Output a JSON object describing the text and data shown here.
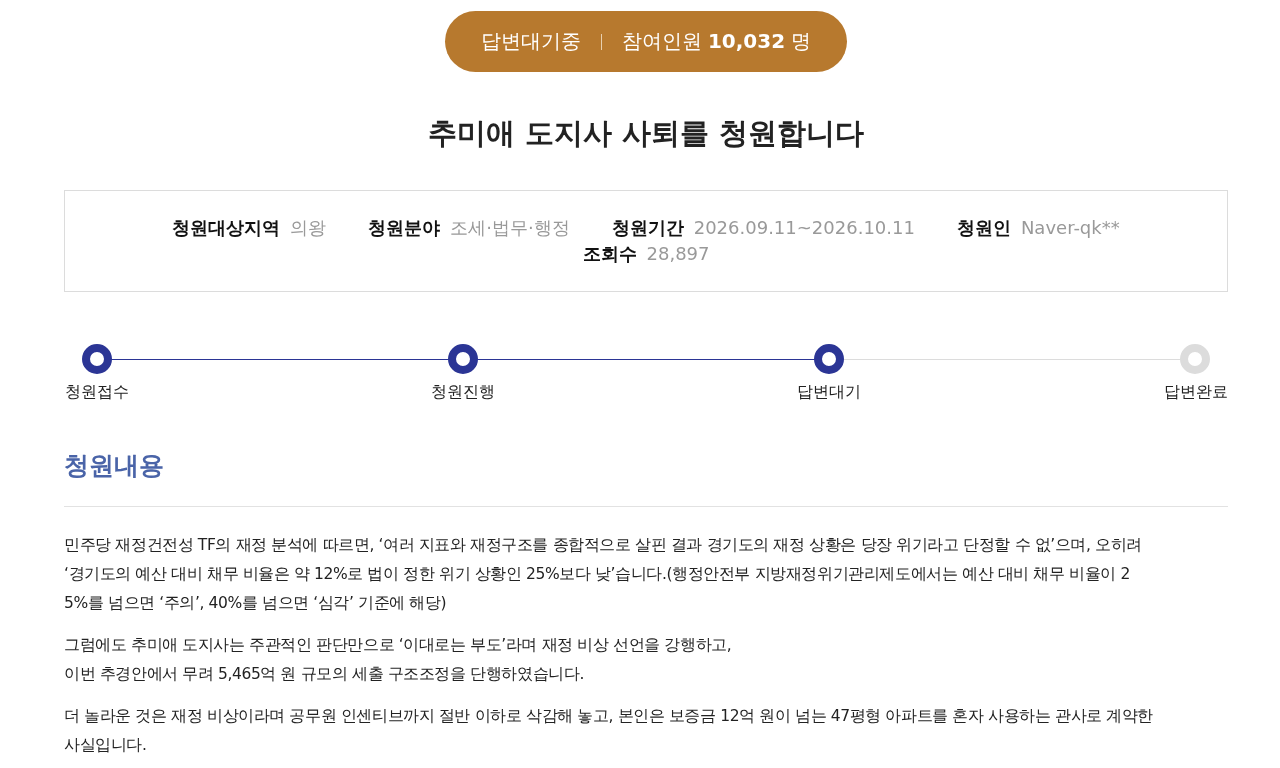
{
  "status_badge": {
    "status": "답변대기중",
    "participants_label": "참여인원",
    "participants_count": "10,032",
    "participants_unit": "명"
  },
  "title": "추미애 도지사 사퇴를 청원합니다",
  "info": [
    {
      "label": "청원대상지역",
      "value": "의왕"
    },
    {
      "label": "청원분야",
      "value": "조세·법무·행정"
    },
    {
      "label": "청원기간",
      "value": "2026.09.11~2026.10.11"
    },
    {
      "label": "청원인",
      "value": "Naver-qk**"
    },
    {
      "label": "조회수",
      "value": "28,897"
    }
  ],
  "progress": [
    {
      "label": "청원접수",
      "done": true
    },
    {
      "label": "청원진행",
      "done": true
    },
    {
      "label": "답변대기",
      "done": true
    },
    {
      "label": "답변완료",
      "done": false
    }
  ],
  "content": {
    "heading": "청원내용",
    "paragraphs": [
      [
        "민주당 재정건전성 TF의 재정 분석에 따르면, ‘여러 지표와 재정구조를 종합적으로 살핀 결과 경기도의 재정 상황은 당장 위기라고 단정할 수 없’으며, 오히려",
        "‘경기도의 예산 대비 채무 비율은 약 12%로 법이 정한 위기 상황인 25%보다 낮’습니다.(행정안전부 지방재정위기관리제도에서는 예산 대비 채무 비율이 2",
        "5%를 넘으면 ‘주의’, 40%를 넘으면 ‘심각’ 기준에 해당)"
      ],
      [
        "그럼에도 추미애 도지사는 주관적인 판단만으로 ‘이대로는 부도’라며 재정 비상 선언을 강행하고,",
        "이번 추경안에서 무려 5,465억 원 규모의 세출 구조조정을 단행하였습니다."
      ],
      [
        "더 놀라운 것은 재정 비상이라며 공무원 인센티브까지 절반 이하로 삭감해 놓고, 본인은 보증금 12억 원이 넘는 47평형 아파트를 혼자 사용하는 관사로 계약한",
        "사실입니다."
      ]
    ]
  }
}
